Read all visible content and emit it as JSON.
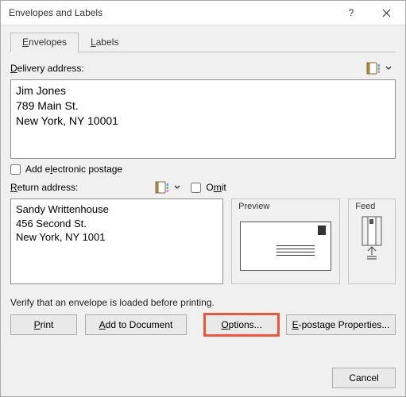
{
  "title": "Envelopes and Labels",
  "tabs": {
    "envelopes": "Envelopes",
    "labels": "Labels",
    "active": "envelopes"
  },
  "sections": {
    "delivery_label": "Delivery address:",
    "return_label": "Return address:",
    "preview_title": "Preview",
    "feed_title": "Feed"
  },
  "addresses": {
    "delivery": "Jim Jones\n789 Main St.\nNew York, NY 10001",
    "return": "Sandy Writtenhouse\n456 Second St.\nNew York, NY 1001"
  },
  "checkbox": {
    "electronic_postage": "Add electronic postage",
    "omit": "Omit"
  },
  "verify_text": "Verify that an envelope is loaded before printing.",
  "buttons": {
    "print": "Print",
    "add_to_doc": "Add to Document",
    "options": "Options...",
    "epostage": "E-postage Properties...",
    "cancel": "Cancel"
  }
}
